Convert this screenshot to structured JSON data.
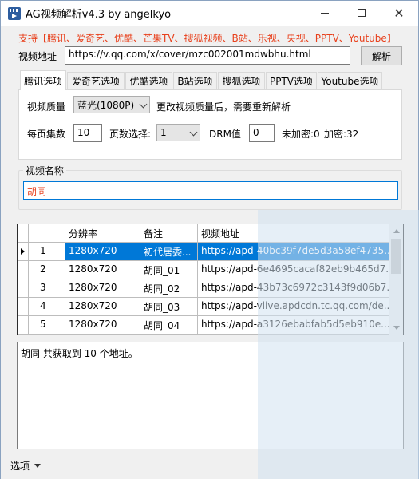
{
  "window": {
    "title": "AG视频解析v4.3 by angelkyo"
  },
  "support_text": "支持【腾讯、爱奇艺、优酷、芒果TV、搜狐视频、B站、乐视、央视、PPTV、Youtube】",
  "url": {
    "label": "视频地址",
    "value": "https://v.qq.com/x/cover/mzc002001mdwbhu.html",
    "button": "解析"
  },
  "tabs": [
    {
      "label": "腾讯选项",
      "active": true
    },
    {
      "label": "爱奇艺选项"
    },
    {
      "label": "优酷选项"
    },
    {
      "label": "B站选项"
    },
    {
      "label": "搜狐选项"
    },
    {
      "label": "PPTV选项"
    },
    {
      "label": "Youtube选项"
    }
  ],
  "tencent": {
    "quality_label": "视频质量",
    "quality_value": "蓝光(1080P)",
    "quality_hint": "更改视频质量后，需要重新解析",
    "per_page_label": "每页集数",
    "per_page_value": "10",
    "page_select_label": "页数选择:",
    "page_select_value": "1",
    "drm_label": "DRM值",
    "drm_value": "0",
    "unencrypted": "未加密:0",
    "encrypted": "加密:32"
  },
  "video_name": {
    "label": "视频名称",
    "value": "胡同"
  },
  "table": {
    "headers": [
      "分辨率",
      "备注",
      "视频地址"
    ],
    "rows": [
      {
        "num": "1",
        "res": "1280x720",
        "note": "初代居委...",
        "url": "https://apd-40bc39f7de5d3a58ef4735..."
      },
      {
        "num": "2",
        "res": "1280x720",
        "note": "胡同_01",
        "url": "https://apd-6e4695cacaf82eb9b465d7..."
      },
      {
        "num": "3",
        "res": "1280x720",
        "note": "胡同_02",
        "url": "https://apd-43b73c6972c3143f9d06b7..."
      },
      {
        "num": "4",
        "res": "1280x720",
        "note": "胡同_03",
        "url": "https://apd-vlive.apdcdn.tc.qq.com/de..."
      },
      {
        "num": "5",
        "res": "1280x720",
        "note": "胡同_04",
        "url": "https://apd-a3126ebabfab5d5eb910e..."
      }
    ]
  },
  "log_text": "胡同 共获取到 10 个地址。",
  "statusbar": {
    "options_label": "选项"
  }
}
